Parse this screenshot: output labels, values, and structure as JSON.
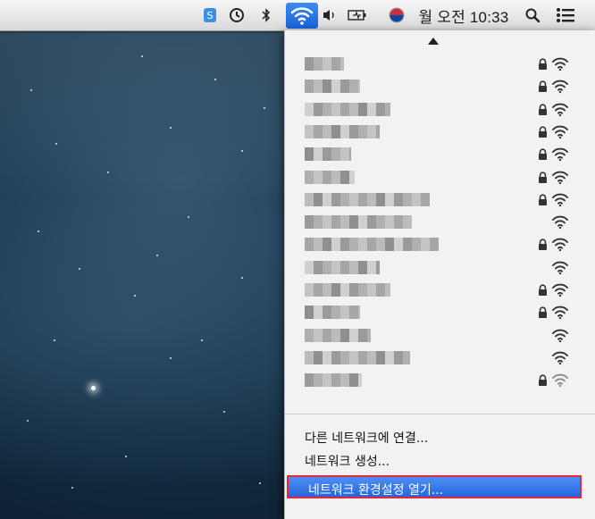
{
  "menubar": {
    "clock_text": "월 오전 10:33",
    "status_icons": [
      "app-icon",
      "time-machine-icon",
      "bluetooth-icon",
      "wifi-icon",
      "volume-icon",
      "battery-icon",
      "input-flag-icon",
      "search-icon",
      "list-icon"
    ]
  },
  "wifi_menu": {
    "networks": [
      {
        "name_hidden": true,
        "secured": true
      },
      {
        "name_hidden": true,
        "secured": true
      },
      {
        "name_hidden": true,
        "secured": true
      },
      {
        "name_hidden": true,
        "secured": true
      },
      {
        "name_hidden": true,
        "secured": true
      },
      {
        "name_hidden": true,
        "secured": true
      },
      {
        "name_hidden": true,
        "secured": true
      },
      {
        "name_hidden": true,
        "secured": false
      },
      {
        "name_hidden": true,
        "secured": true
      },
      {
        "name_hidden": true,
        "secured": false
      },
      {
        "name_hidden": true,
        "secured": true
      },
      {
        "name_hidden": true,
        "secured": true
      },
      {
        "name_hidden": true,
        "secured": false
      },
      {
        "name_hidden": true,
        "secured": false
      },
      {
        "name_hidden": true,
        "secured": true
      }
    ],
    "join_other_label": "다른 네트워크에 연결...",
    "create_network_label": "네트워크 생성...",
    "open_prefs_label": "네트워크 환경설정 열기..."
  },
  "colors": {
    "menu_highlight": "#2566de",
    "callout_border": "#d81e2e"
  }
}
